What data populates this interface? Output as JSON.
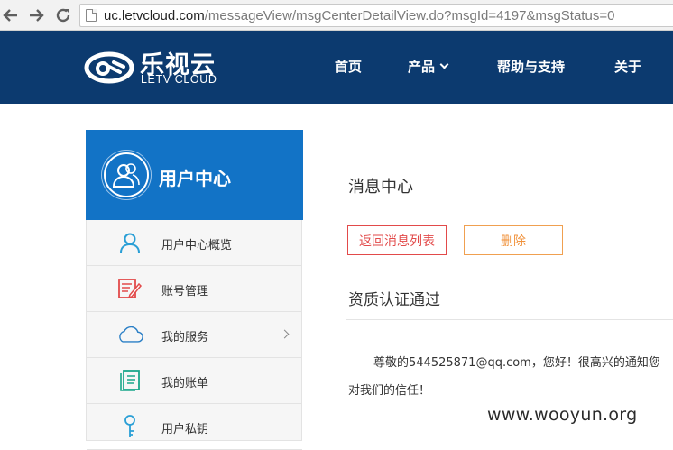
{
  "browser": {
    "url_host": "uc.letvcloud.com",
    "url_path": "/messageView/msgCenterDetailView.do?msgId=4197&msgStatus=0",
    "back_icon": "arrow-left-icon",
    "forward_icon": "arrow-right-icon",
    "reload_icon": "reload-icon"
  },
  "header": {
    "logo_cn": "乐视云",
    "logo_en": "LETV CLOUD",
    "nav": {
      "home": "首页",
      "products": "产品",
      "help": "帮助与支持",
      "about": "关于"
    },
    "bg_color": "#0c3a6f"
  },
  "sidebar": {
    "title": "用户中心",
    "header_color": "#1273c6",
    "items": [
      {
        "label": "用户中心概览",
        "icon": "user-icon"
      },
      {
        "label": "账号管理",
        "icon": "edit-document-icon"
      },
      {
        "label": "我的服务",
        "icon": "cloud-icon"
      },
      {
        "label": "我的账单",
        "icon": "bill-icon"
      },
      {
        "label": "用户私钥",
        "icon": "key-icon"
      }
    ]
  },
  "main": {
    "title": "消息中心",
    "back_button": "返回消息列表",
    "delete_button": "删除",
    "subject": "资质认证通过",
    "body_line1": "尊敬的544525871@qq.com，您好！很高兴的通知您",
    "body_line2": "对我们的信任！"
  },
  "watermark": "www.wooyun.org"
}
